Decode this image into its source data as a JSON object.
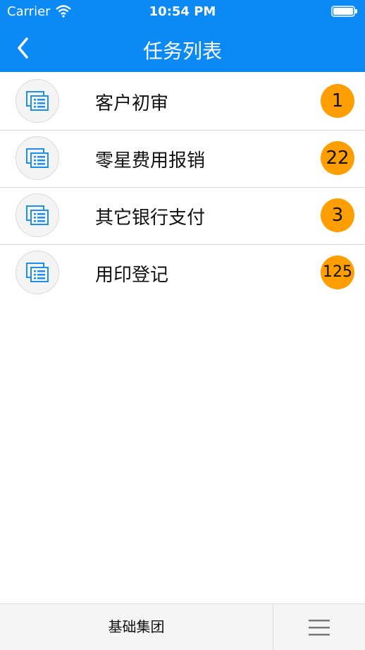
{
  "status": {
    "carrier": "Carrier",
    "time": "10:54 PM"
  },
  "nav": {
    "title": "任务列表",
    "back_icon": "chevron-left-icon"
  },
  "tasks": [
    {
      "label": "客户初审",
      "count": "1"
    },
    {
      "label": "零星费用报销",
      "count": "22"
    },
    {
      "label": "其它银行支付",
      "count": "3"
    },
    {
      "label": "用印登记",
      "count": "125"
    }
  ],
  "footer": {
    "company": "基础集团",
    "menu_icon": "hamburger-menu-icon"
  },
  "colors": {
    "header": "#0b8af5",
    "badge": "#ff9e00",
    "icon": "#1e8ef0"
  }
}
